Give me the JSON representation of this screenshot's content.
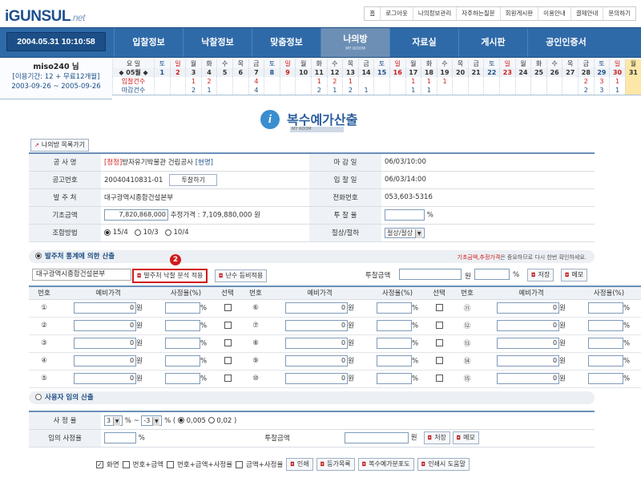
{
  "header": {
    "logo": "iGUNSUL",
    "logo_suffix": ".net",
    "toplinks": [
      "홈",
      "로그아웃",
      "나의정보관리",
      "자주하는질문",
      "회원게시판",
      "이용안내",
      "결제안내",
      "문의하기"
    ],
    "datetime": "2004.05.31 10:10:58"
  },
  "nav": [
    {
      "label": "입찰정보"
    },
    {
      "label": "낙찰정보"
    },
    {
      "label": "맞춤정보"
    },
    {
      "label": "나의방",
      "sub": "MY ROOM",
      "active": true
    },
    {
      "label": "자료실"
    },
    {
      "label": "게시판"
    },
    {
      "label": "공인인증서"
    }
  ],
  "user": {
    "name": "miso240 님",
    "plan": "[이용기간: 12 + 무료12개월]",
    "period": "2003-09-26 ~ 2005-09-26"
  },
  "calendar": {
    "label_weekday": "요 일",
    "month": "◆ 05월 ◆",
    "row_bid": "입찰건수",
    "row_close": "마감건수",
    "weekdays": [
      "토",
      "일",
      "월",
      "화",
      "수",
      "목",
      "금",
      "토",
      "일",
      "월",
      "화",
      "수",
      "목",
      "금",
      "토",
      "일",
      "월",
      "화",
      "수",
      "목",
      "금",
      "토",
      "일",
      "월",
      "화",
      "수",
      "목",
      "금",
      "토",
      "일",
      "월"
    ],
    "days": [
      "1",
      "2",
      "3",
      "4",
      "5",
      "6",
      "7",
      "8",
      "9",
      "10",
      "11",
      "12",
      "13",
      "14",
      "15",
      "16",
      "17",
      "18",
      "19",
      "20",
      "21",
      "22",
      "23",
      "24",
      "25",
      "26",
      "27",
      "28",
      "29",
      "30",
      "31"
    ],
    "bids": [
      "",
      "",
      "1",
      "2",
      "",
      "",
      "4",
      "",
      "",
      "",
      "1",
      "2",
      "1",
      "",
      "",
      "",
      "1",
      "1",
      "1",
      "",
      "",
      "",
      "",
      "",
      "",
      "",
      "",
      "2",
      "3",
      "1",
      ""
    ],
    "closes": [
      "",
      "",
      "2",
      "1",
      "",
      "",
      "4",
      "",
      "",
      "",
      "2",
      "1",
      "2",
      "1",
      "",
      "",
      "1",
      "1",
      "",
      "",
      "",
      "",
      "",
      "",
      "",
      "",
      "",
      "2",
      "3",
      "1",
      ""
    ]
  },
  "page": {
    "title": "복수예가산출",
    "subtitle": "MY ROOM",
    "back_button": "나의방 목록가기"
  },
  "info": {
    "project_label": "공 사 명",
    "project_tag": "[정정]",
    "project_name": "방자유기박물관 건립공사",
    "project_tag2": "[현명]",
    "deadline_label": "마 감 일",
    "deadline": "06/03/10:00",
    "notice_label": "공고번호",
    "notice_no": "20040410831-01",
    "notice_btn": "투찰하기",
    "bid_date_label": "입 찰 일",
    "bid_date": "06/03/14:00",
    "orderer_label": "발 주 처",
    "orderer": "대구광역시종합건설본부",
    "phone_label": "전화번호",
    "phone": "053,603-5316",
    "base_label": "기초금액",
    "base_amount": "7,820,868,000",
    "est_price": "추정가격 : 7,109,880,000 원",
    "bid_rate_label": "투 찰 율",
    "pct": "%",
    "method_label": "조합방법",
    "methods": [
      "15/4",
      "10/3",
      "10/4"
    ],
    "cut_label": "절상/절하",
    "cut_value": "절상/절상"
  },
  "section1": {
    "title": "발주처 통계에 의한 산출",
    "note_red": "기초금액,추정가격",
    "note_rest": "은 중요하므로 다시 한번 확인하세요.",
    "orderer": "대구광역시종합건설본부",
    "btn_apply": "발주처 낙찰 분석 적용",
    "btn_random": "난수 등비적용",
    "bid_amount_label": "투찰금액",
    "won": "원",
    "pct": "%",
    "btn_save": "저장",
    "btn_memo": "메모"
  },
  "rate_table": {
    "headers": [
      "번호",
      "예비가격",
      "사정율(%)",
      "선택"
    ],
    "won": "원",
    "pct": "%",
    "rows": [
      [
        {
          "no": "①",
          "val": "0"
        },
        {
          "no": "⑥",
          "val": "0"
        },
        {
          "no": "⑪",
          "val": "0"
        }
      ],
      [
        {
          "no": "②",
          "val": "0"
        },
        {
          "no": "⑦",
          "val": "0"
        },
        {
          "no": "⑫",
          "val": "0"
        }
      ],
      [
        {
          "no": "③",
          "val": "0"
        },
        {
          "no": "⑧",
          "val": "0"
        },
        {
          "no": "⑬",
          "val": "0"
        }
      ],
      [
        {
          "no": "④",
          "val": "0"
        },
        {
          "no": "⑨",
          "val": "0"
        },
        {
          "no": "⑭",
          "val": "0"
        }
      ],
      [
        {
          "no": "⑤",
          "val": "0"
        },
        {
          "no": "⑩",
          "val": "0"
        },
        {
          "no": "⑮",
          "val": "0"
        }
      ]
    ]
  },
  "section2": {
    "title": "사용자 임의 산출",
    "rate_label": "사 정 율",
    "rate_from": "3",
    "rate_to": "-3",
    "pct_tilde": "% ~",
    "pct_open": "% (",
    "opt1": "0,005",
    "opt2": "0,02 )",
    "any_rate_label": "임의 사정율",
    "pct": "%",
    "bid_amount_label": "투찰금액",
    "won": "원",
    "btn_save": "저장",
    "btn_memo": "메모"
  },
  "footer": {
    "opts": [
      "화면",
      "번호+금액",
      "번호+금액+사정율",
      "금액+사정율"
    ],
    "btns": [
      "인쇄",
      "등가목록",
      "복수예가분포도",
      "인쇄시 도움말"
    ]
  },
  "badge": "2"
}
